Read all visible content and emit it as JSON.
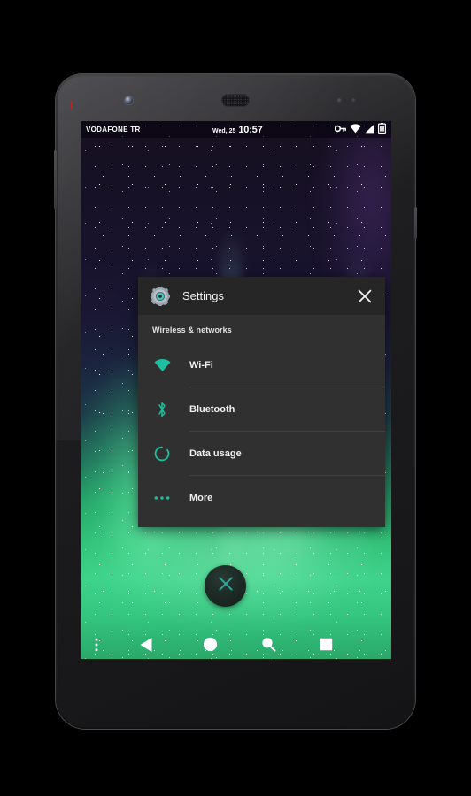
{
  "device": {
    "model_style": "nexus-phone"
  },
  "statusbar": {
    "carrier": "VODAFONE TR",
    "date": "Wed, 25",
    "time": "10:57",
    "icons": [
      "vpn-key-icon",
      "wifi-icon",
      "cellular-signal-icon",
      "battery-icon"
    ]
  },
  "dialog": {
    "title": "Settings",
    "gear_icon": "gear-icon",
    "close_icon": "close-icon",
    "section_header": "Wireless & networks",
    "items": [
      {
        "label": "Wi-Fi",
        "icon": "wifi-icon"
      },
      {
        "label": "Bluetooth",
        "icon": "bluetooth-icon"
      },
      {
        "label": "Data usage",
        "icon": "data-usage-icon"
      },
      {
        "label": "More",
        "icon": "more-dots-icon"
      }
    ]
  },
  "fab": {
    "icon": "close-x-icon",
    "label": ""
  },
  "navbar": {
    "buttons": [
      {
        "name": "menu",
        "icon": "menu-dots-icon"
      },
      {
        "name": "back",
        "icon": "back-triangle-icon"
      },
      {
        "name": "home",
        "icon": "home-circle-icon"
      },
      {
        "name": "search",
        "icon": "search-icon"
      },
      {
        "name": "recents",
        "icon": "recents-square-icon"
      }
    ]
  },
  "colors": {
    "accent_teal": "#1bbfa0",
    "dialog_bg": "#303030",
    "dialog_header_bg": "#262626",
    "text_primary": "#f0f0f0",
    "wallpaper_top": "#15101f",
    "wallpaper_bottom": "#2aa86a"
  }
}
